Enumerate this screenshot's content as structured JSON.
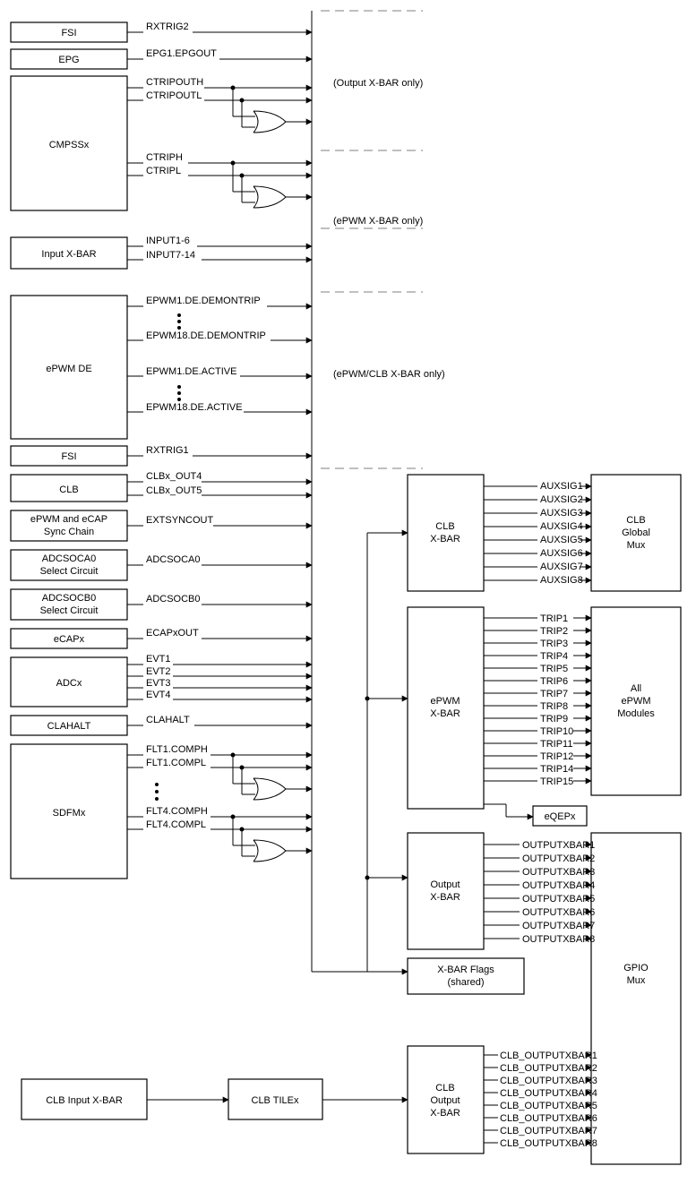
{
  "sources": {
    "fsi2": {
      "label": "FSI",
      "signals": [
        "RXTRIG2"
      ]
    },
    "epg": {
      "label": "EPG",
      "signals": [
        "EPG1.EPGOUT"
      ]
    },
    "cmpssx": {
      "label": "CMPSSx",
      "signals_top": [
        "CTRIPOUTH",
        "CTRIPOUTL"
      ],
      "signals_bot": [
        "CTRIPH",
        "CTRIPL"
      ]
    },
    "inputxbar": {
      "label": "Input X-BAR",
      "signals": [
        "INPUT1-6",
        "INPUT7-14"
      ]
    },
    "epwmde": {
      "label": "ePWM DE",
      "signals_top": [
        "EPWM1.DE.DEMONTRIP",
        "EPWM18.DE.DEMONTRIP"
      ],
      "signals_bot": [
        "EPWM1.DE.ACTIVE",
        "EPWM18.DE.ACTIVE"
      ]
    },
    "fsi1": {
      "label": "FSI",
      "signals": [
        "RXTRIG1"
      ]
    },
    "clb": {
      "label": "CLB",
      "signals": [
        "CLBx_OUT4",
        "CLBx_OUT5"
      ]
    },
    "sync": {
      "label": "ePWM and eCAP Sync Chain",
      "signals": [
        "EXTSYNCOUT"
      ]
    },
    "adcsoca": {
      "label": "ADCSOCA0 Select Circuit",
      "signals": [
        "ADCSOCA0"
      ]
    },
    "adcsocb": {
      "label": "ADCSOCB0 Select Circuit",
      "signals": [
        "ADCSOCB0"
      ]
    },
    "ecap": {
      "label": "eCAPx",
      "signals": [
        "ECAPxOUT"
      ]
    },
    "adcx": {
      "label": "ADCx",
      "signals": [
        "EVT1",
        "EVT2",
        "EVT3",
        "EVT4"
      ]
    },
    "clahalt": {
      "label": "CLAHALT",
      "signals": [
        "CLAHALT"
      ]
    },
    "sdfmx": {
      "label": "SDFMx",
      "signals_top": [
        "FLT1.COMPH",
        "FLT1.COMPL"
      ],
      "signals_bot": [
        "FLT4.COMPH",
        "FLT4.COMPL"
      ]
    }
  },
  "notes": {
    "out_only": "(Output X-BAR only)",
    "epwm_only": "(ePWM X-BAR only)",
    "epwm_clb_only": "(ePWM/CLB X-BAR only)"
  },
  "xbars": {
    "clb": {
      "label": "CLB X-BAR",
      "target": "CLB Global Mux",
      "signals": [
        "AUXSIG1",
        "AUXSIG2",
        "AUXSIG3",
        "AUXSIG4",
        "AUXSIG5",
        "AUXSIG6",
        "AUXSIG7",
        "AUXSIG8"
      ]
    },
    "epwm": {
      "label": "ePWM X-BAR",
      "target": "All ePWM Modules",
      "signals": [
        "TRIP1",
        "TRIP2",
        "TRIP3",
        "TRIP4",
        "TRIP5",
        "TRIP6",
        "TRIP7",
        "TRIP8",
        "TRIP9",
        "TRIP10",
        "TRIP11",
        "TRIP12",
        "TRIP14",
        "TRIP15"
      ]
    },
    "eqep": {
      "label": "eQEPx"
    },
    "output": {
      "label": "Output X-BAR",
      "target": "GPIO Mux",
      "signals": [
        "OUTPUTXBAR1",
        "OUTPUTXBAR2",
        "OUTPUTXBAR3",
        "OUTPUTXBAR4",
        "OUTPUTXBAR5",
        "OUTPUTXBAR6",
        "OUTPUTXBAR7",
        "OUTPUTXBAR8"
      ]
    },
    "flags": {
      "label_l1": "X-BAR Flags",
      "label_l2": "(shared)"
    },
    "clbout": {
      "label": "CLB Output X-BAR",
      "signals": [
        "CLB_OUTPUTXBAR1",
        "CLB_OUTPUTXBAR2",
        "CLB_OUTPUTXBAR3",
        "CLB_OUTPUTXBAR4",
        "CLB_OUTPUTXBAR5",
        "CLB_OUTPUTXBAR6",
        "CLB_OUTPUTXBAR7",
        "CLB_OUTPUTXBAR8"
      ]
    }
  },
  "bottom": {
    "clbinputxbar": "CLB Input X-BAR",
    "clbtilex": "CLB TILEx"
  }
}
